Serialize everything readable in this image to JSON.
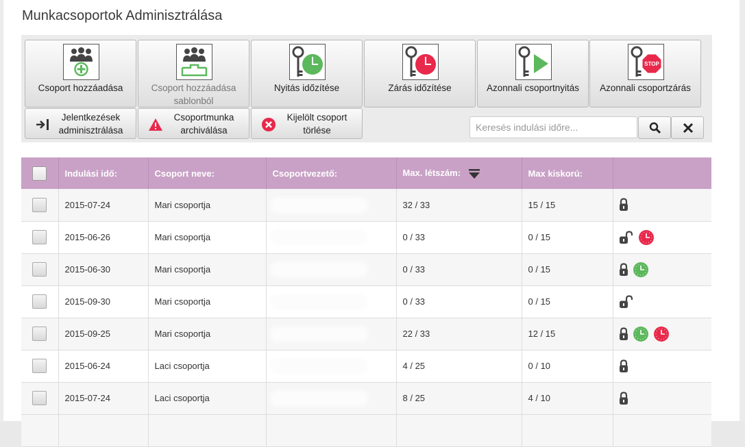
{
  "page": {
    "title": "Munkacsoportok Adminisztrálása"
  },
  "toolbar": {
    "big_buttons": [
      {
        "label": "Csoport hozzáadása",
        "icon": "group-add-icon"
      },
      {
        "label": "Csoport hozzáadása sablonból",
        "icon": "group-template-icon"
      },
      {
        "label": "Nyitás időzítése",
        "icon": "key-green-clock-icon"
      },
      {
        "label": "Zárás időzítése",
        "icon": "key-red-clock-icon"
      },
      {
        "label": "Azonnali csoportnyitás",
        "icon": "key-play-icon"
      },
      {
        "label": "Azonnali csoportzárás",
        "icon": "key-stop-icon",
        "stop_text": "STOP"
      }
    ],
    "small_buttons": [
      {
        "label": "Jelentkezések adminisztrálása",
        "icon": "sign-in-icon"
      },
      {
        "label": "Csoportmunka archiválása",
        "icon": "warning-icon"
      },
      {
        "label": "Kijelölt csoport törlése",
        "icon": "delete-circle-icon"
      }
    ],
    "search": {
      "placeholder": "Keresés indulási időre...",
      "value": ""
    }
  },
  "table": {
    "headers": {
      "start": "Indulási idő:",
      "name": "Csoport neve:",
      "leader": "Csoportvezető:",
      "max": "Max. létszám:",
      "minor": "Max kiskorú:"
    },
    "rows": [
      {
        "date": "2015-07-24",
        "name": "Mari csoportja",
        "max": "32 / 33",
        "minor": "15 / 15",
        "status": [
          "lock-closed"
        ]
      },
      {
        "date": "2015-06-26",
        "name": "Mari csoportja",
        "max": "0 / 33",
        "minor": "0 / 15",
        "status": [
          "lock-open",
          "clock-red"
        ]
      },
      {
        "date": "2015-06-30",
        "name": "Mari csoportja",
        "max": "0 / 33",
        "minor": "0 / 15",
        "status": [
          "lock-closed",
          "clock-green"
        ]
      },
      {
        "date": "2015-09-30",
        "name": "Mari csoportja",
        "max": "0 / 33",
        "minor": "0 / 15",
        "status": [
          "lock-open"
        ]
      },
      {
        "date": "2015-09-25",
        "name": "Mari csoportja",
        "max": "22 / 33",
        "minor": "12 / 15",
        "status": [
          "lock-closed",
          "clock-green",
          "clock-red"
        ]
      },
      {
        "date": "2015-06-24",
        "name": "Laci csoportja",
        "max": "4 / 25",
        "minor": "0 / 10",
        "status": [
          "lock-closed"
        ]
      },
      {
        "date": "2015-07-24",
        "name": "Laci csoportja",
        "max": "8 / 25",
        "minor": "4 / 10",
        "status": [
          "lock-closed"
        ]
      }
    ]
  },
  "colors": {
    "header": "#c9a1c6",
    "green": "#5cb85c",
    "red": "#e8294b"
  }
}
